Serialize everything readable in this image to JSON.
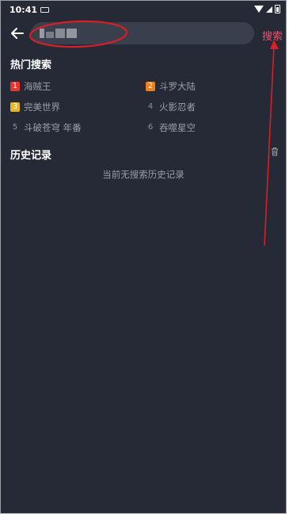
{
  "status_bar": {
    "time": "10:41"
  },
  "header": {
    "back_icon": "arrow-left-icon",
    "search_value": "",
    "search_button_label": "搜索"
  },
  "hot_search": {
    "title": "热门搜索",
    "items": [
      {
        "rank": "1",
        "label": "海贼王",
        "badge_color": "#e8362f"
      },
      {
        "rank": "2",
        "label": "斗罗大陆",
        "badge_color": "#f07d1a"
      },
      {
        "rank": "3",
        "label": "完美世界",
        "badge_color": "#e8b51a"
      },
      {
        "rank": "4",
        "label": "火影忍者",
        "badge_color": ""
      },
      {
        "rank": "5",
        "label": "斗破苍穹 年番",
        "badge_color": ""
      },
      {
        "rank": "6",
        "label": "吞噬星空",
        "badge_color": ""
      }
    ]
  },
  "history": {
    "title": "历史记录",
    "clear_icon": "trash-icon",
    "empty_text": "当前无搜索历史记录"
  },
  "colors": {
    "background": "#262a36",
    "accent": "#f0506e",
    "annotation": "#d61f26"
  }
}
